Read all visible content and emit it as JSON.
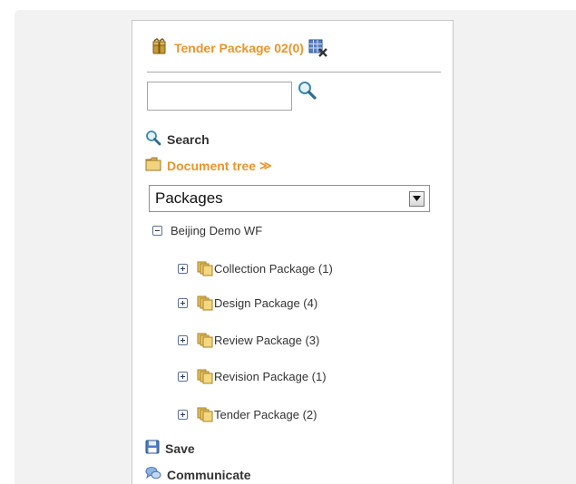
{
  "package_header": {
    "title": "Tender Package 02(0)"
  },
  "search": {
    "placeholder": "",
    "label": "Search"
  },
  "document_tree": {
    "label": "Document tree",
    "arrow": "≫"
  },
  "packages_select": {
    "selected": "Packages"
  },
  "tree": {
    "root": "Beijing Demo WF",
    "children": [
      {
        "label": "Collection Package (1)"
      },
      {
        "label": "Design Package (4)"
      },
      {
        "label": "Review Package (3)"
      },
      {
        "label": "Revision Package (1)"
      },
      {
        "label": "Tender Package (2)"
      }
    ]
  },
  "actions": {
    "save": "Save",
    "communicate": "Communicate"
  },
  "colors": {
    "accent": "#e8962b",
    "background": "#f2f2f2",
    "panel": "#ffffff"
  }
}
